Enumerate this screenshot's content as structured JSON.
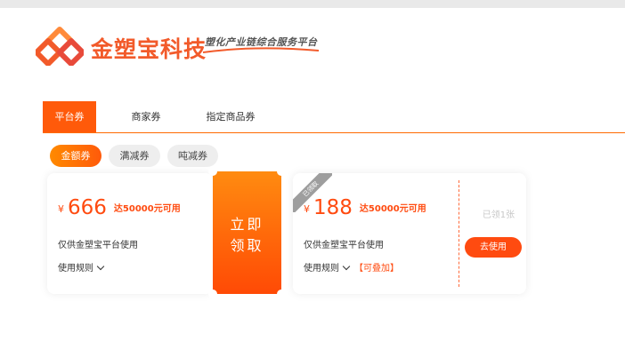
{
  "brand": {
    "name": "金塑宝科技",
    "slogan": "塑化产业链综合服务平台",
    "colors": {
      "primary": "#ff5a0a",
      "logo_red": "#f25a2a",
      "logo_orange": "#ff8a3a"
    }
  },
  "tabs": [
    {
      "label": "平台券",
      "active": true
    },
    {
      "label": "商家券",
      "active": false
    },
    {
      "label": "指定商品券",
      "active": false
    }
  ],
  "filters": [
    {
      "label": "金额券",
      "active": true
    },
    {
      "label": "满减券",
      "active": false
    },
    {
      "label": "吨减券",
      "active": false
    }
  ],
  "coupons": [
    {
      "currency": "¥",
      "amount": "666",
      "condition": "达50000元可用",
      "scope": "仅供金塑宝平台使用",
      "rules_label": "使用规则",
      "action_line1": "立即",
      "action_line2": "领取"
    },
    {
      "ribbon": "已领取",
      "currency": "¥",
      "amount": "188",
      "condition": "达50000元可用",
      "scope": "仅供金塑宝平台使用",
      "rules_label": "使用规则",
      "stackable": "【可叠加】",
      "claimed_text": "已领1张",
      "action_label": "去使用"
    }
  ]
}
